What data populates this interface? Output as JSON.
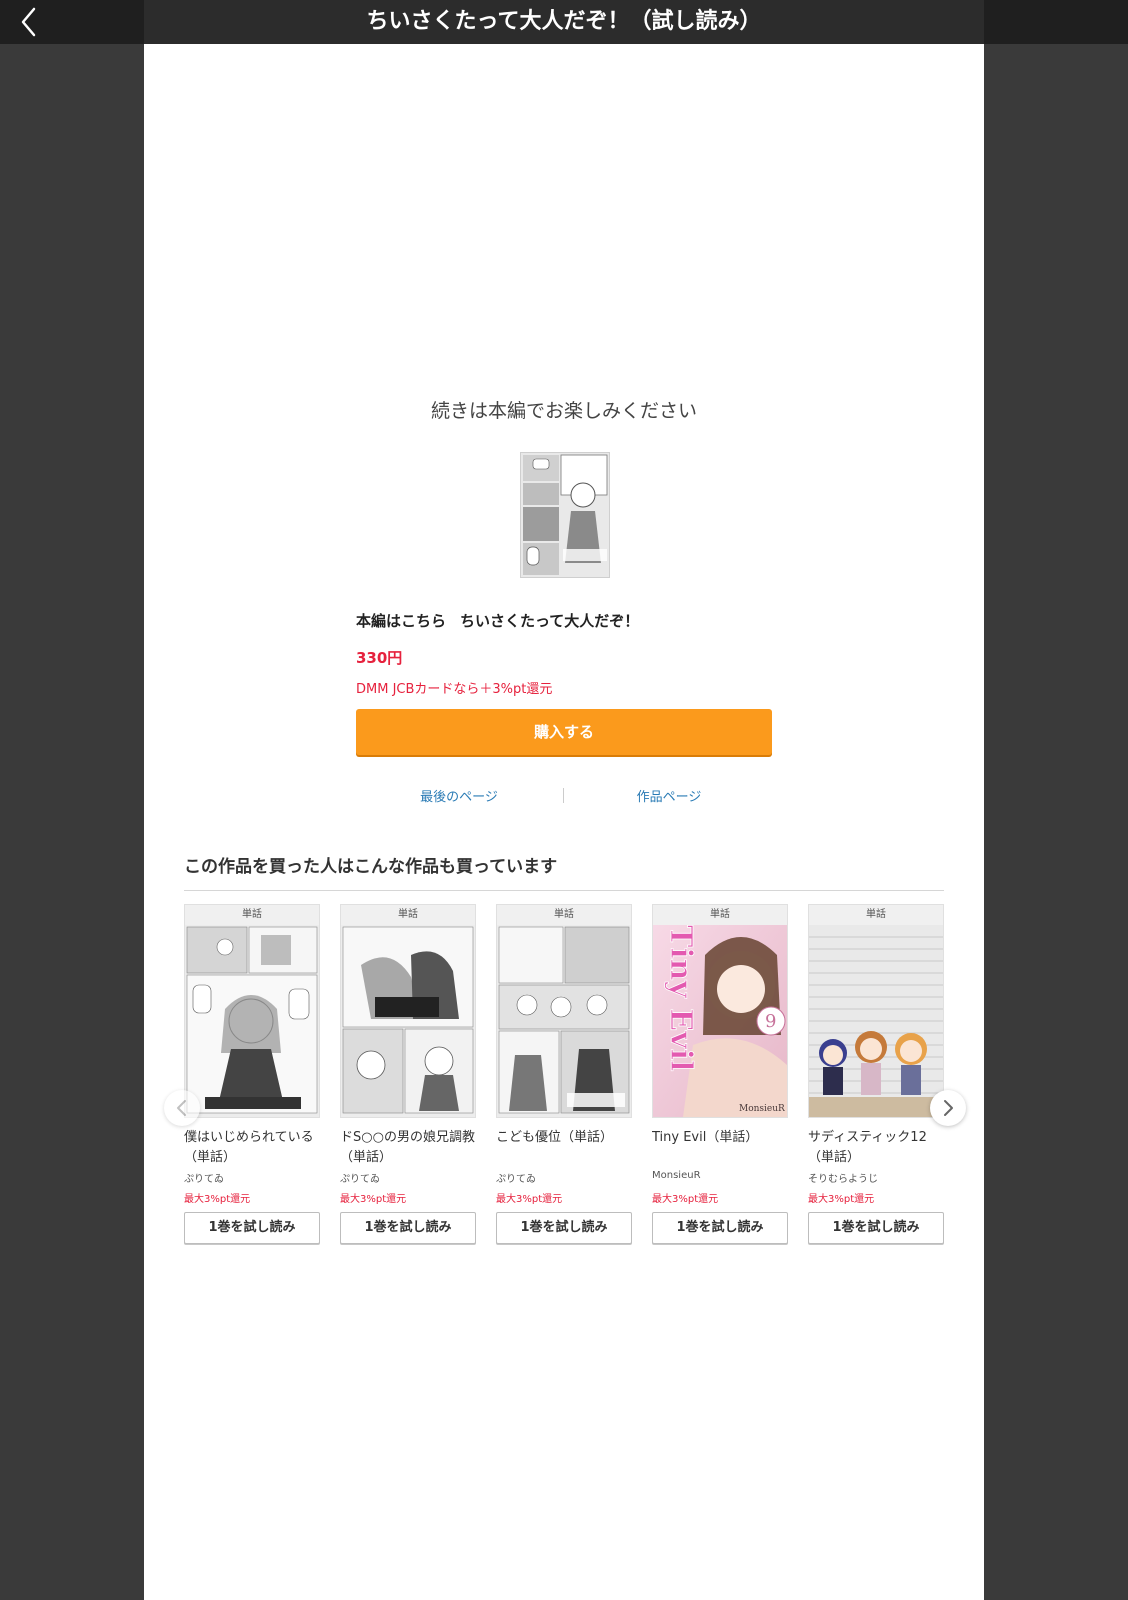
{
  "header": {
    "title": "ちいさくたって大人だぞ！（試し読み）",
    "back_icon": "chevron-left-icon"
  },
  "end_message": "続きは本編でお楽しみください",
  "product": {
    "intro": "本編はこちら",
    "title": "ちいさくたって大人だぞ！",
    "price": "330円",
    "cashback": "DMM JCBカードなら＋3%pt還元",
    "buy_label": "購入する",
    "accent_color": "#fb9a1c",
    "price_color": "#e6213d"
  },
  "links": {
    "last_page": "最後のページ",
    "work_page": "作品ページ"
  },
  "recommend": {
    "title": "この作品を買った人はこんな作品も買っています",
    "items": [
      {
        "badge": "単話",
        "title": "僕はいじめられている（単話）",
        "author": "ぷりてゐ",
        "point": "最大3%pt還元",
        "button": "1巻を試し読み"
      },
      {
        "badge": "単話",
        "title": "ドS○○の男の娘兄調教（単話）",
        "author": "ぷりてゐ",
        "point": "最大3%pt還元",
        "button": "1巻を試し読み"
      },
      {
        "badge": "単話",
        "title": "こども優位（単話）",
        "author": "ぷりてゐ",
        "point": "最大3%pt還元",
        "button": "1巻を試し読み"
      },
      {
        "badge": "単話",
        "title": "Tiny Evil（単話）",
        "author": "MonsieuR",
        "point": "最大3%pt還元",
        "button": "1巻を試し読み",
        "cover_text": "Tiny Evil",
        "cover_number": "9",
        "cover_author": "MonsieuR"
      },
      {
        "badge": "単話",
        "title": "サディスティック12（単話）",
        "author": "そりむらようじ",
        "point": "最大3%pt還元",
        "button": "1巻を試し読み"
      }
    ]
  }
}
